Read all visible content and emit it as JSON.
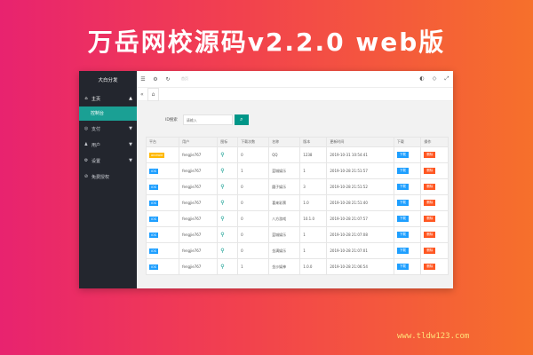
{
  "headline": "万岳网校源码v2.2.0 web版",
  "watermark": "www.tldw123.com",
  "sidebar": {
    "title": "大白分发",
    "items": [
      {
        "label": "主页",
        "icon": "home-icon",
        "arrow": "▲"
      },
      {
        "label": "控制台",
        "sub": true
      },
      {
        "label": "支付",
        "icon": "payment-icon",
        "arrow": "▼"
      },
      {
        "label": "用户",
        "icon": "user-icon",
        "arrow": "▼"
      },
      {
        "label": "设置",
        "icon": "settings-icon",
        "arrow": "▼"
      },
      {
        "label": "免费授权",
        "icon": "license-icon",
        "arrow": ""
      }
    ]
  },
  "topbar": {
    "menu": "☰",
    "settings": "⚙",
    "refresh": "↻",
    "muted": "首页"
  },
  "tabs": {
    "back": "«",
    "home": "⌂"
  },
  "search": {
    "label": "ID搜索",
    "placeholder": "请输入"
  },
  "table": {
    "headers": [
      "平台",
      "用户",
      "图标",
      "下载次数",
      "名称",
      "版本",
      "更新时间",
      "下载",
      "操作"
    ],
    "rows": [
      {
        "plat": "android",
        "user": "fengjie767",
        "dl": "0",
        "name": "QQ",
        "ver": "1238",
        "time": "2019-10-31 10:54:41"
      },
      {
        "plat": "ios",
        "user": "fengjie767",
        "dl": "1",
        "name": "蓝城娱乐",
        "ver": "1",
        "time": "2019-10-28 21:51:57"
      },
      {
        "plat": "ios",
        "user": "fengjie767",
        "dl": "0",
        "name": "圆子娱乐",
        "ver": "3",
        "time": "2019-10-28 21:51:52"
      },
      {
        "plat": "ios",
        "user": "fengjie767",
        "dl": "0",
        "name": "喜来彩票",
        "ver": "1.0",
        "time": "2019-10-28 21:51:40"
      },
      {
        "plat": "ios",
        "user": "fengjie767",
        "dl": "0",
        "name": "八方游戏",
        "ver": "10.1.0",
        "time": "2019-10-28 21:07:57"
      },
      {
        "plat": "ios",
        "user": "fengjie767",
        "dl": "0",
        "name": "蓝城娱乐",
        "ver": "1",
        "time": "2019-10-28 21:07:08"
      },
      {
        "plat": "ios",
        "user": "fengjie767",
        "dl": "0",
        "name": "金满娱乐",
        "ver": "1",
        "time": "2019-10-28 21:07:01"
      },
      {
        "plat": "ios",
        "user": "fengjie767",
        "dl": "1",
        "name": "金沙娱神",
        "ver": "1.0.0",
        "time": "2019-10-28 21:06:54"
      }
    ],
    "plat_labels": {
      "android": "android",
      "ios": "iOS"
    },
    "download_label": "下载",
    "delete_label": "删除"
  }
}
